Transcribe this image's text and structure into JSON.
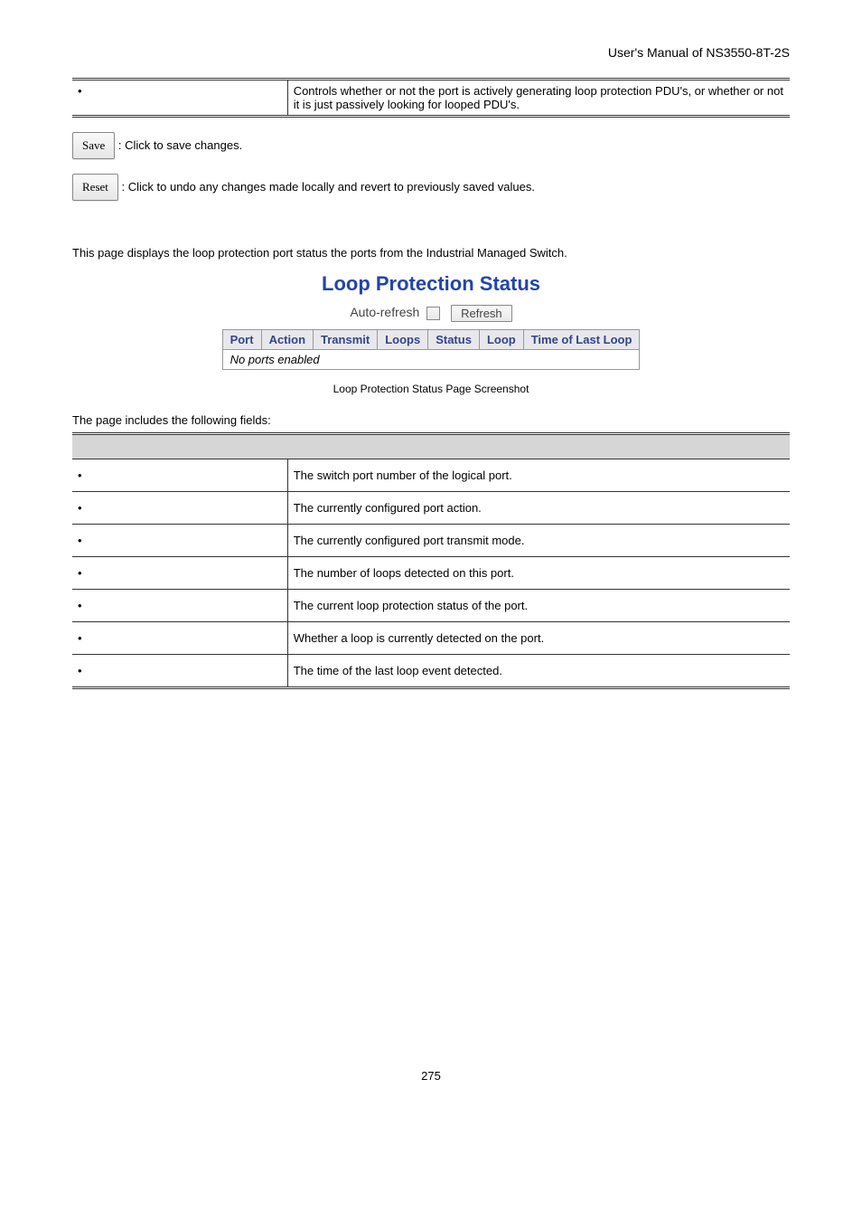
{
  "header": "User's Manual of NS3550-8T-2S",
  "top_row": {
    "description": "Controls whether or not the port is actively generating loop protection PDU's, or whether or not it is just passively looking for looped PDU's."
  },
  "save": {
    "label": "Save",
    "desc": ": Click to save changes."
  },
  "reset": {
    "label": "Reset",
    "desc": ": Click to undo any changes made locally and revert to previously saved values."
  },
  "intro": "This page displays the loop protection port status the ports from the Industrial Managed Switch.",
  "screenshot": {
    "title": "Loop Protection Status",
    "auto_refresh": "Auto-refresh",
    "refresh": "Refresh",
    "cols": [
      "Port",
      "Action",
      "Transmit",
      "Loops",
      "Status",
      "Loop",
      "Time of Last Loop"
    ],
    "empty": "No ports enabled",
    "caption": "Loop Protection Status Page Screenshot"
  },
  "fields_intro": "The page includes the following fields:",
  "fields": [
    {
      "desc": "The switch port number of the logical port."
    },
    {
      "desc": "The currently configured port action."
    },
    {
      "desc": "The currently configured port transmit mode."
    },
    {
      "desc": "The number of loops detected on this port."
    },
    {
      "desc": "The current loop protection status of the port."
    },
    {
      "desc": "Whether a loop is currently detected on the port."
    },
    {
      "desc": "The time of the last loop event detected."
    }
  ],
  "page_num": "275"
}
